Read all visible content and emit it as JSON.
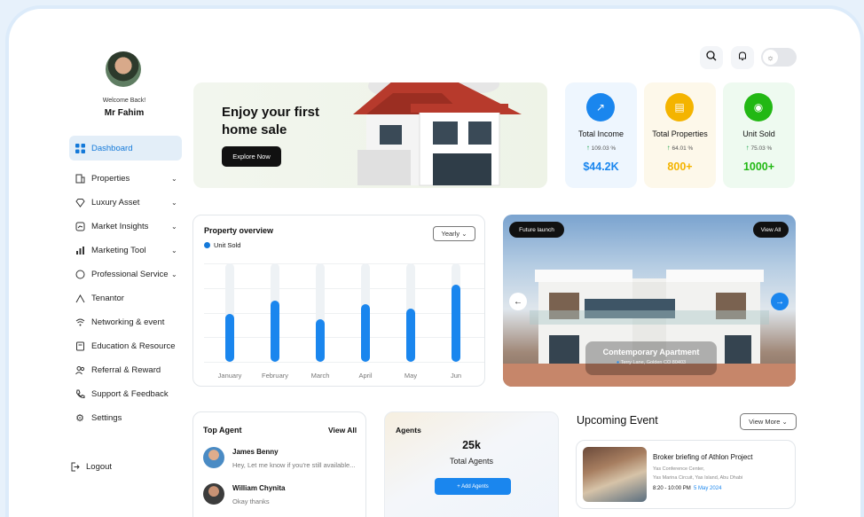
{
  "user": {
    "welcome": "Welcome Back!",
    "name": "Mr Fahim"
  },
  "sidebar": {
    "items": [
      {
        "label": "Dashboard",
        "icon": "grid-icon",
        "active": true
      },
      {
        "label": "Properties",
        "icon": "building-icon",
        "chevron": true
      },
      {
        "label": "Luxury Asset",
        "icon": "diamond-icon",
        "chevron": true
      },
      {
        "label": "Market Insights",
        "icon": "insights-icon",
        "chevron": true
      },
      {
        "label": "Marketing Tool",
        "icon": "bar-chart-icon",
        "chevron": true
      },
      {
        "label": "Professional Service",
        "icon": "service-icon",
        "chevron": true
      },
      {
        "label": "Tenantor",
        "icon": "tenantor-icon"
      },
      {
        "label": "Networking & event",
        "icon": "wifi-icon"
      },
      {
        "label": "Education & Resource",
        "icon": "book-icon"
      },
      {
        "label": "Referral & Reward",
        "icon": "users-icon"
      },
      {
        "label": "Support & Feedback",
        "icon": "phone-icon"
      },
      {
        "label": "Settings",
        "icon": "gear-icon"
      }
    ],
    "logout": "Logout"
  },
  "hero": {
    "title": "Enjoy your first home sale",
    "button": "Explore Now"
  },
  "stats": [
    {
      "title": "Total Income",
      "percent": "109.03 %",
      "value": "$44.2K",
      "color": "#1a86ee",
      "bg": "#eef6fe",
      "icon": "trend-icon"
    },
    {
      "title": "Total Properties",
      "percent": "64.01 %",
      "value": "800+",
      "color": "#f4b400",
      "bg": "#fdf8ea",
      "icon": "document-icon"
    },
    {
      "title": "Unit Sold",
      "percent": "75.03 %",
      "value": "1000+",
      "color": "#22b814",
      "bg": "#eefaf0",
      "icon": "sold-icon"
    }
  ],
  "chart_card": {
    "title": "Property overview",
    "legend": "Unit Sold",
    "period": "Yearly"
  },
  "chart_data": {
    "type": "bar",
    "categories": [
      "January",
      "February",
      "March",
      "April",
      "May",
      "Jun"
    ],
    "series": [
      {
        "name": "Unit Sold",
        "values": [
          49,
          62,
          43,
          59,
          54,
          78
        ]
      }
    ],
    "ylim": [
      0,
      100
    ],
    "grid": true,
    "legend": "top-left"
  },
  "property": {
    "badge": "Future launch",
    "view_all": "View All",
    "name": "Contemporary Apartment",
    "address": "Terry Lane, Golden CO 80403"
  },
  "top_agent": {
    "title": "Top Agent",
    "view_all": "View All",
    "agents": [
      {
        "name": "James Benny",
        "message": "Hey, Let me know if you're still available..."
      },
      {
        "name": "William Chynita",
        "message": "Okay thanks"
      }
    ]
  },
  "agents_card": {
    "title": "Agents",
    "count": "25k",
    "label": "Total Agents",
    "button": "+ Add Agents"
  },
  "events": {
    "title": "Upcoming Event",
    "view_more": "View More",
    "items": [
      {
        "name": "Broker briefing of Athlon Project",
        "venue": "Yas Conference Center,",
        "address": "Yas Marina Circuit, Yas Island, Abu Dhabi",
        "time": "8:20 - 10:00 PM",
        "date": "5 May 2024"
      }
    ]
  }
}
